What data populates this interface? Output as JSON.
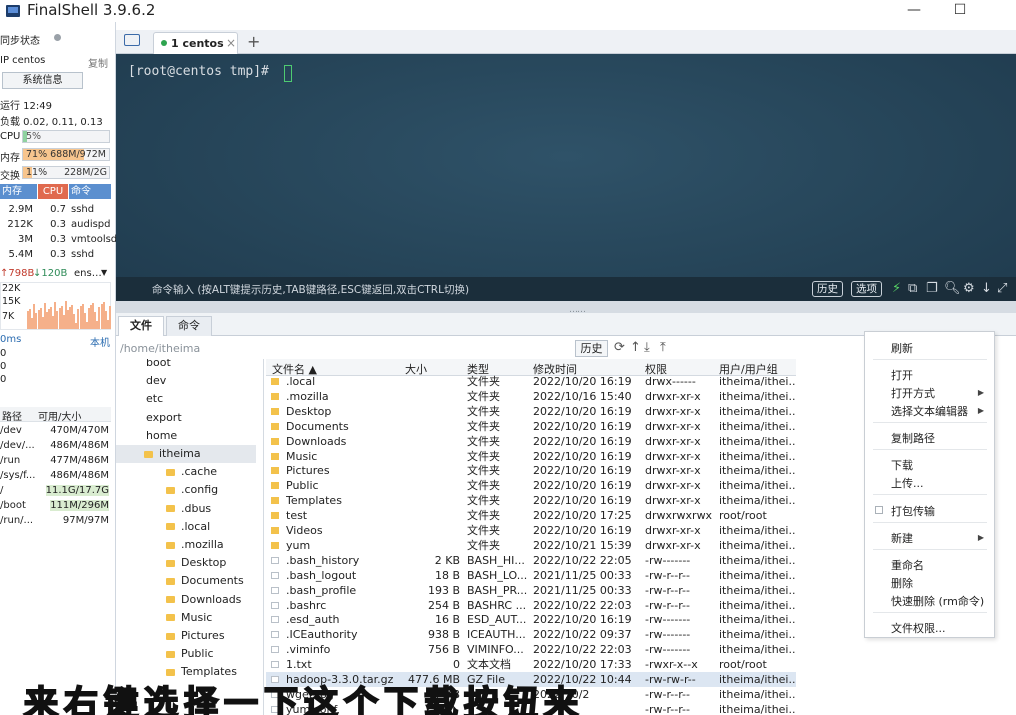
{
  "window": {
    "title": "FinalShell 3.9.6.2",
    "minimize": "—",
    "maximize": "☐"
  },
  "left": {
    "sync_status": "同步状态",
    "ip_label": "IP centos",
    "copy": "复制",
    "sysinfo": "系统信息",
    "uptime": "运行 12:49",
    "load": "负载 0.02, 0.11, 0.13",
    "cpu_label": "CPU",
    "cpu_value": "5%",
    "cpu_pct": 5,
    "mem_label": "内存",
    "mem_value": "71%  688M/972M",
    "mem_pct": 71,
    "swap_label": "交换",
    "swap_pct_text": "11%",
    "swap_value": "228M/2G",
    "swap_pct": 11,
    "proc_headers": [
      "内存",
      "CPU",
      "命令"
    ],
    "processes": [
      {
        "mem": "2.9M",
        "cpu": "0.7",
        "cmd": "sshd"
      },
      {
        "mem": "212K",
        "cpu": "0.3",
        "cmd": "audispd"
      },
      {
        "mem": "3M",
        "cpu": "0.3",
        "cmd": "vmtoolsd"
      },
      {
        "mem": "5.4M",
        "cpu": "0.3",
        "cmd": "sshd"
      }
    ],
    "net_up": "↑798B",
    "net_down": "↓120B",
    "net_iface": "ens…",
    "net_scale": [
      "22K",
      "15K",
      "7K"
    ],
    "ping_label": "0ms",
    "ping_host": "本机",
    "ping_values": [
      "0",
      "0",
      "0"
    ],
    "disk_headers": [
      "路径",
      "可用/大小"
    ],
    "disks": [
      {
        "path": "/dev",
        "size": "470M/470M"
      },
      {
        "path": "/dev/...",
        "size": "486M/486M"
      },
      {
        "path": "/run",
        "size": "477M/486M"
      },
      {
        "path": "/sys/f...",
        "size": "486M/486M"
      },
      {
        "path": "/",
        "size": "11.1G/17.7G"
      },
      {
        "path": "/boot",
        "size": "111M/296M"
      },
      {
        "path": "/run/...",
        "size": "97M/97M"
      }
    ]
  },
  "tabs": {
    "session": "1 centos",
    "close": "×",
    "add": "+"
  },
  "terminal": {
    "prompt": "[root@centos tmp]#"
  },
  "cmdbar": {
    "hint": "命令输入 (按ALT键提示历史,TAB键路径,ESC键返回,双击CTRL切换)",
    "history": "历史",
    "options": "选项"
  },
  "lower_tabs": [
    "文件",
    "命令"
  ],
  "pathbar": {
    "path": "/home/itheima",
    "history": "历史"
  },
  "tree": [
    {
      "label": "boot",
      "depth": 1
    },
    {
      "label": "dev",
      "depth": 1
    },
    {
      "label": "etc",
      "depth": 1
    },
    {
      "label": "export",
      "depth": 1
    },
    {
      "label": "home",
      "depth": 1
    },
    {
      "label": "itheima",
      "depth": 2
    },
    {
      "label": ".cache",
      "depth": 3
    },
    {
      "label": ".config",
      "depth": 3
    },
    {
      "label": ".dbus",
      "depth": 3
    },
    {
      "label": ".local",
      "depth": 3
    },
    {
      "label": ".mozilla",
      "depth": 3
    },
    {
      "label": "Desktop",
      "depth": 3
    },
    {
      "label": "Documents",
      "depth": 3
    },
    {
      "label": "Downloads",
      "depth": 3
    },
    {
      "label": "Music",
      "depth": 3
    },
    {
      "label": "Pictures",
      "depth": 3
    },
    {
      "label": "Public",
      "depth": 3
    },
    {
      "label": "Templates",
      "depth": 3
    }
  ],
  "file_headers": [
    "文件名 ▲",
    "大小",
    "类型",
    "修改时间",
    "权限",
    "用户/用户组"
  ],
  "files": [
    {
      "name": ".local",
      "size": "",
      "type": "文件夹",
      "mtime": "2022/10/20 16:19",
      "perm": "drwx------",
      "owner": "itheima/ithei...",
      "folder": true
    },
    {
      "name": ".mozilla",
      "size": "",
      "type": "文件夹",
      "mtime": "2022/10/16 15:40",
      "perm": "drwxr-xr-x",
      "owner": "itheima/ithei...",
      "folder": true
    },
    {
      "name": "Desktop",
      "size": "",
      "type": "文件夹",
      "mtime": "2022/10/20 16:19",
      "perm": "drwxr-xr-x",
      "owner": "itheima/ithei...",
      "folder": true
    },
    {
      "name": "Documents",
      "size": "",
      "type": "文件夹",
      "mtime": "2022/10/20 16:19",
      "perm": "drwxr-xr-x",
      "owner": "itheima/ithei...",
      "folder": true
    },
    {
      "name": "Downloads",
      "size": "",
      "type": "文件夹",
      "mtime": "2022/10/20 16:19",
      "perm": "drwxr-xr-x",
      "owner": "itheima/ithei...",
      "folder": true
    },
    {
      "name": "Music",
      "size": "",
      "type": "文件夹",
      "mtime": "2022/10/20 16:19",
      "perm": "drwxr-xr-x",
      "owner": "itheima/ithei...",
      "folder": true
    },
    {
      "name": "Pictures",
      "size": "",
      "type": "文件夹",
      "mtime": "2022/10/20 16:19",
      "perm": "drwxr-xr-x",
      "owner": "itheima/ithei...",
      "folder": true
    },
    {
      "name": "Public",
      "size": "",
      "type": "文件夹",
      "mtime": "2022/10/20 16:19",
      "perm": "drwxr-xr-x",
      "owner": "itheima/ithei...",
      "folder": true
    },
    {
      "name": "Templates",
      "size": "",
      "type": "文件夹",
      "mtime": "2022/10/20 16:19",
      "perm": "drwxr-xr-x",
      "owner": "itheima/ithei...",
      "folder": true
    },
    {
      "name": "test",
      "size": "",
      "type": "文件夹",
      "mtime": "2022/10/20 17:25",
      "perm": "drwxrwxrwx",
      "owner": "root/root",
      "folder": true
    },
    {
      "name": "Videos",
      "size": "",
      "type": "文件夹",
      "mtime": "2022/10/20 16:19",
      "perm": "drwxr-xr-x",
      "owner": "itheima/ithei...",
      "folder": true
    },
    {
      "name": "yum",
      "size": "",
      "type": "文件夹",
      "mtime": "2022/10/21 15:39",
      "perm": "drwxr-xr-x",
      "owner": "itheima/ithei...",
      "folder": true
    },
    {
      "name": ".bash_history",
      "size": "2 KB",
      "type": "BASH_HI...",
      "mtime": "2022/10/22 22:05",
      "perm": "-rw-------",
      "owner": "itheima/ithei...",
      "folder": false
    },
    {
      "name": ".bash_logout",
      "size": "18 B",
      "type": "BASH_LO...",
      "mtime": "2021/11/25 00:33",
      "perm": "-rw-r--r--",
      "owner": "itheima/ithei...",
      "folder": false
    },
    {
      "name": ".bash_profile",
      "size": "193 B",
      "type": "BASH_PR...",
      "mtime": "2021/11/25 00:33",
      "perm": "-rw-r--r--",
      "owner": "itheima/ithei...",
      "folder": false
    },
    {
      "name": ".bashrc",
      "size": "254 B",
      "type": "BASHRC ...",
      "mtime": "2022/10/22 22:03",
      "perm": "-rw-r--r--",
      "owner": "itheima/ithei...",
      "folder": false
    },
    {
      "name": ".esd_auth",
      "size": "16 B",
      "type": "ESD_AUT...",
      "mtime": "2022/10/20 16:19",
      "perm": "-rw-------",
      "owner": "itheima/ithei...",
      "folder": false
    },
    {
      "name": ".ICEauthority",
      "size": "938 B",
      "type": "ICEAUTH...",
      "mtime": "2022/10/22 09:37",
      "perm": "-rw-------",
      "owner": "itheima/ithei...",
      "folder": false
    },
    {
      "name": ".viminfo",
      "size": "756 B",
      "type": "VIMINFO...",
      "mtime": "2022/10/22 22:03",
      "perm": "-rw-------",
      "owner": "itheima/ithei...",
      "folder": false
    },
    {
      "name": "1.txt",
      "size": "0",
      "type": "文本文档",
      "mtime": "2022/10/20 17:33",
      "perm": "-rwxr-x--x",
      "owner": "root/root",
      "folder": false
    },
    {
      "name": "hadoop-3.3.0.tar.gz",
      "size": "477.6 MB",
      "type": "GZ File",
      "mtime": "2022/10/22 10:44",
      "perm": "-rw-rw-r--",
      "owner": "itheima/ithei...",
      "folder": false,
      "selected": true
    },
    {
      "name": "wget-log",
      "size": "7 KB",
      "type": "",
      "mtime": "2022/10/2",
      "perm": "-rw-r--r--",
      "owner": "itheima/ithei...",
      "folder": false
    },
    {
      "name": "yum.conf",
      "size": "",
      "type": "",
      "mtime": "",
      "perm": "-rw-r--r--",
      "owner": "itheima/ithei...",
      "folder": false
    }
  ],
  "context_menu": {
    "refresh": "刷新",
    "open": "打开",
    "open_with": "打开方式",
    "choose_editor": "选择文本编辑器",
    "copy_path": "复制路径",
    "download": "下载",
    "upload": "上传...",
    "pack_transfer": "打包传输",
    "new": "新建",
    "rename": "重命名",
    "delete": "删除",
    "quick_delete": "快速删除 (rm命令)",
    "permissions": "文件权限..."
  },
  "caption": "来右键选择一下这个下载按钮来",
  "colors": {
    "terminal_bg": "#264559",
    "cmdbar_bg": "#1b2e3b",
    "accent_blue": "#5b8fcf",
    "proc_header": "#5b8fcf",
    "cpu_header": "#e06a4f",
    "green": "#4ecb71"
  }
}
